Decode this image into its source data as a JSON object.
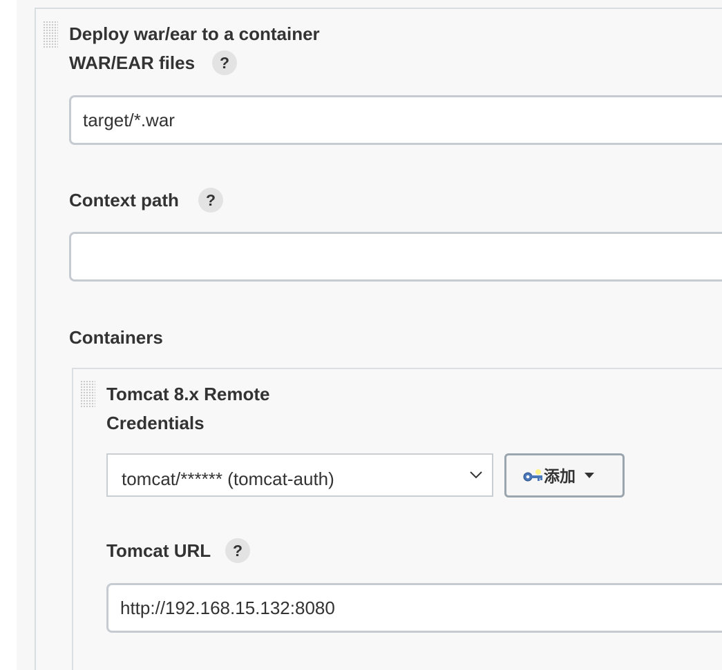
{
  "deploy_step": {
    "title": "Deploy war/ear to a container",
    "war_files": {
      "label": "WAR/EAR files",
      "help": "?",
      "value": "target/*.war"
    },
    "context_path": {
      "label": "Context path",
      "help": "?",
      "value": ""
    },
    "containers_label": "Containers",
    "container": {
      "title": "Tomcat 8.x Remote",
      "credentials": {
        "label": "Credentials",
        "selected": "tomcat/****** (tomcat-auth)",
        "add_button_label": "添加",
        "add_button_icon": "key-icon"
      },
      "tomcat_url": {
        "label": "Tomcat URL",
        "help": "?",
        "value": "http://192.168.15.132:8080"
      }
    }
  },
  "colors": {
    "panel_background": "#f8f8f8",
    "input_border": "#c5cbd0",
    "button_border": "#9aa5ad",
    "help_badge": "#e3e3e3",
    "text": "#333333"
  }
}
